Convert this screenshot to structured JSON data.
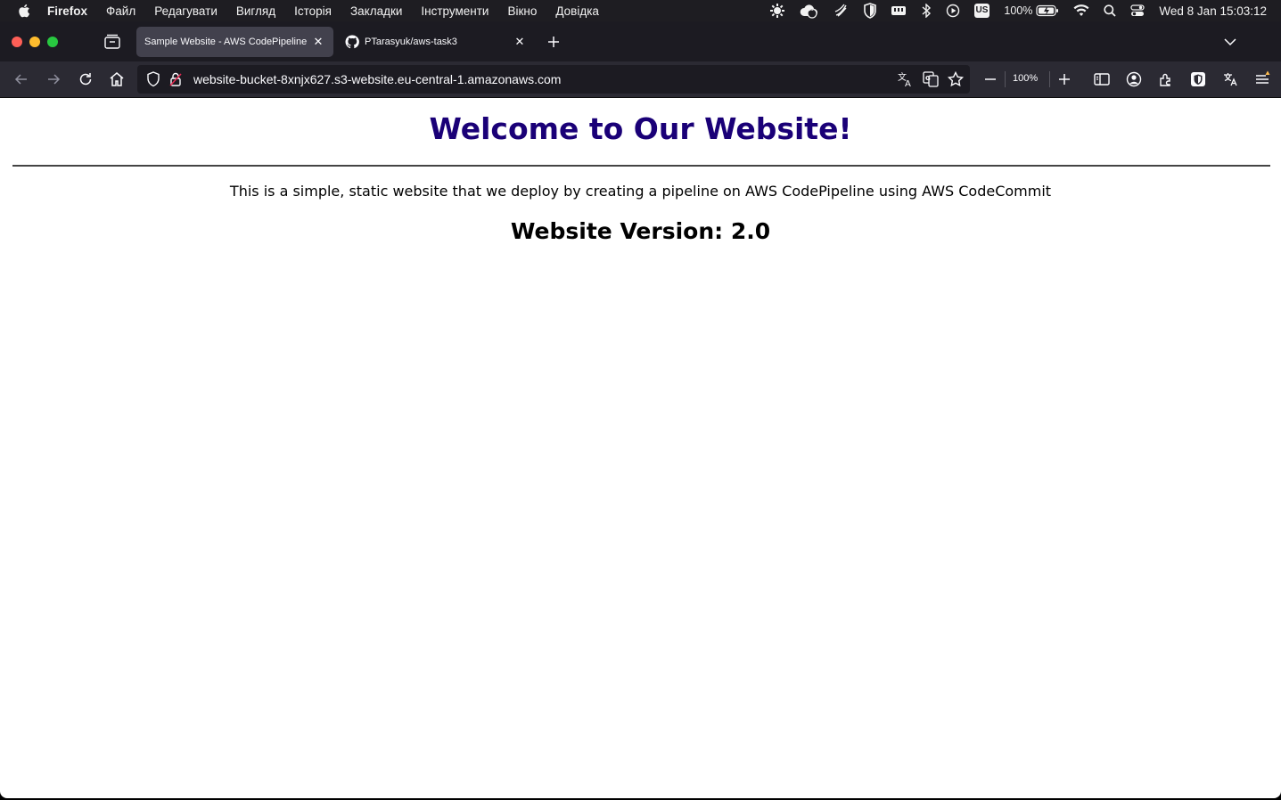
{
  "menubar": {
    "app_name": "Firefox",
    "items": [
      "Файл",
      "Редагувати",
      "Вигляд",
      "Історія",
      "Закладки",
      "Інструменти",
      "Вікно",
      "Довідка"
    ],
    "battery": "100%",
    "keyboard_layout": "US",
    "notification_count": "11",
    "clock": "Wed 8 Jan  15:03:12"
  },
  "tabs": [
    {
      "title": "Sample Website - AWS CodePipeline",
      "active": true
    },
    {
      "title": "PTarasyuk/aws-task3",
      "active": false,
      "icon": "github-icon"
    }
  ],
  "navbar": {
    "url": "website-bucket-8xnjx627.s3-website.eu-central-1.amazonaws.com",
    "zoom": "100%"
  },
  "page": {
    "heading": "Welcome to Our Website!",
    "description": "This is a simple, static website that we deploy by creating a pipeline on AWS CodePipeline using AWS CodeCommit",
    "version": "Website Version: 2.0"
  },
  "colors": {
    "heading": "#1a0077",
    "chrome_dark": "#1c1b22",
    "active_tab": "#42414d"
  }
}
